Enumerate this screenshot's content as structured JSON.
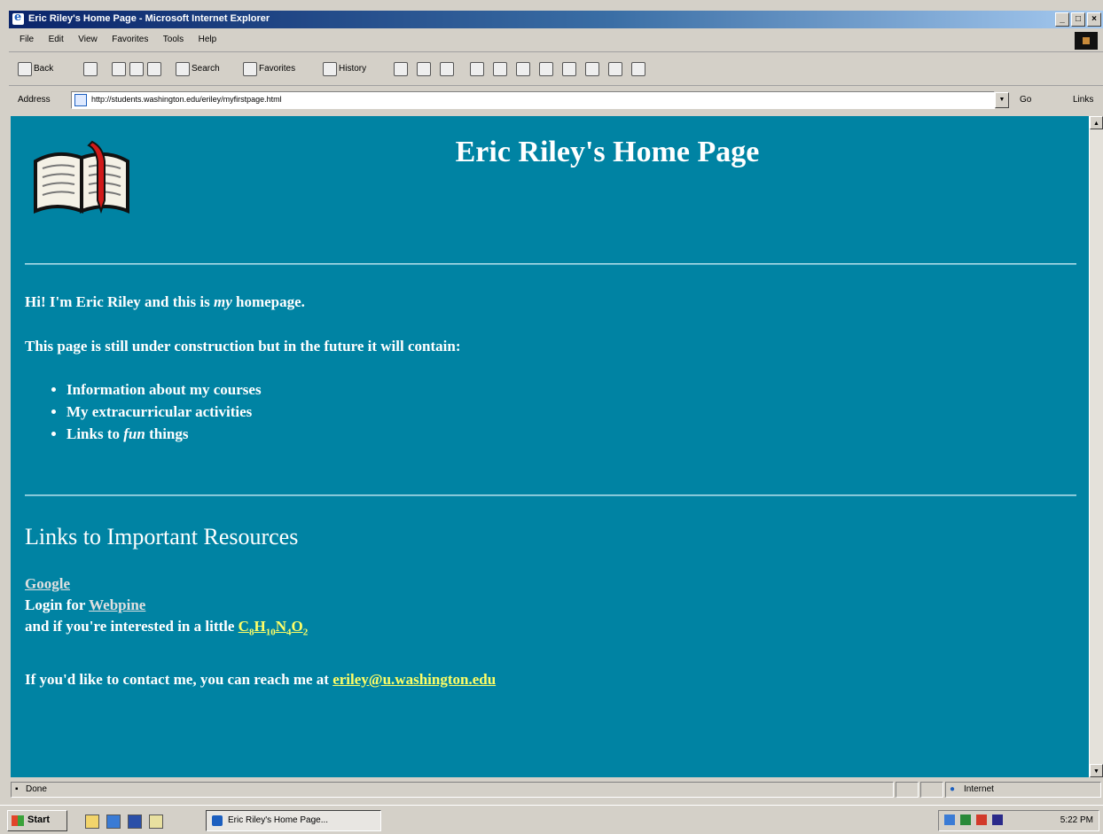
{
  "window": {
    "title": "Eric Riley's Home Page - Microsoft Internet Explorer",
    "controls": [
      "_",
      "□",
      "×"
    ]
  },
  "menu": [
    "File",
    "Edit",
    "View",
    "Favorites",
    "Tools",
    "Help"
  ],
  "toolbar": {
    "back": "Back",
    "search": "Search",
    "favorites": "Favorites",
    "history": "History"
  },
  "address": {
    "label": "Address",
    "url": "http://students.washington.edu/eriley/myfirstpage.html",
    "go": "Go",
    "links": "Links"
  },
  "page": {
    "heading": "Eric Riley's Home Page",
    "intro_pre": "Hi! I'm Eric Riley and this is ",
    "intro_em": "my",
    "intro_post": " homepage.",
    "construction": "This page is still under construction but in the future it will contain:",
    "future_items": [
      "Information about my courses",
      "My extracurricular activities"
    ],
    "future_item3_pre": "Links to ",
    "future_item3_em": "fun",
    "future_item3_post": " things",
    "resources_heading": "Links to Important Resources",
    "google_link": "Google",
    "login_text": "Login for ",
    "webpine_link": "Webpine",
    "caffeine_text": "and if you're interested in a little ",
    "caffeine": {
      "c": "C",
      "c_n": "8",
      "h": "H",
      "h_n": "10",
      "n": "N",
      "n_n": "4",
      "o": "O",
      "o_n": "2"
    },
    "contact_text": "If you'd like to contact me, you can reach me at ",
    "email": "eriley@u.washington.edu"
  },
  "status": {
    "text": "Done",
    "zone": "Internet"
  },
  "taskbar": {
    "start": "Start",
    "task": "Eric Riley's Home Page...",
    "clock": "5:22 PM"
  },
  "colors": {
    "page_background": "#0083a3",
    "text": "#ffffff",
    "visited_link": "#e0e0e0",
    "active_link": "#ffff66"
  }
}
